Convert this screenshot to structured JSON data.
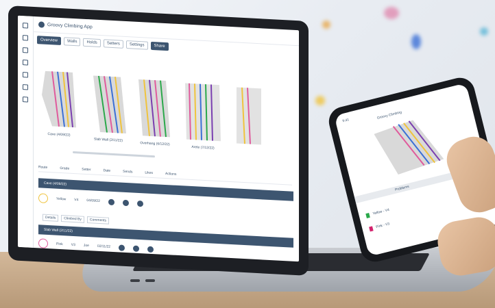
{
  "laptop": {
    "app_title": "Groovy Climbing App",
    "toolbar": {
      "chips": [
        "Overview",
        "Walls",
        "Holds",
        "Setters",
        "Settings",
        "Share"
      ]
    },
    "walls": [
      {
        "label": "Cave (4/09/22)"
      },
      {
        "label": "Slab Wall (2/11/22)"
      },
      {
        "label": "Overhang (6/12/22)"
      },
      {
        "label": "Arete (7/12/22)"
      }
    ],
    "table": {
      "headers": [
        "Route",
        "Grade",
        "Setter",
        "Date",
        "Sends",
        "Likes",
        "Actions"
      ],
      "group1_title": "Cave (4/09/22)",
      "row1": {
        "name": "Yellow",
        "grade": "V4",
        "date": "04/09/22"
      },
      "subtabs": [
        "Details",
        "Climbed By",
        "Comments"
      ],
      "group2_title": "Slab Wall (2/11/22)",
      "row2": {
        "name": "Pink",
        "grade": "V3",
        "setter": "Joe",
        "date": "02/11/22"
      }
    }
  },
  "phone": {
    "time": "9:41",
    "title": "Groovy Climbing",
    "section": "Problems",
    "rows": [
      "Yellow - V4",
      "Pink - V3"
    ]
  },
  "colors": {
    "accent": "#3d5570",
    "route_yellow": "#f0c33c",
    "route_pink": "#e05a9c"
  }
}
